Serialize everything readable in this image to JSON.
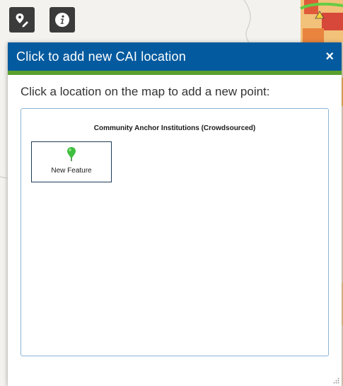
{
  "toolbar": {
    "edit_icon": "pin-pencil-icon",
    "info_icon": "info-icon"
  },
  "panel": {
    "title": "Click to add new CAI location",
    "close_label": "×",
    "instruction": "Click a location on the map to add a new point:",
    "layer_title": "Community Anchor Institutions (Crowdsourced)",
    "template": {
      "label": "New Feature",
      "icon": "green-pin-icon"
    }
  },
  "colors": {
    "header_bg": "#045a9e",
    "header_accent": "#5aa02c",
    "pin": "#3fbf3f"
  }
}
